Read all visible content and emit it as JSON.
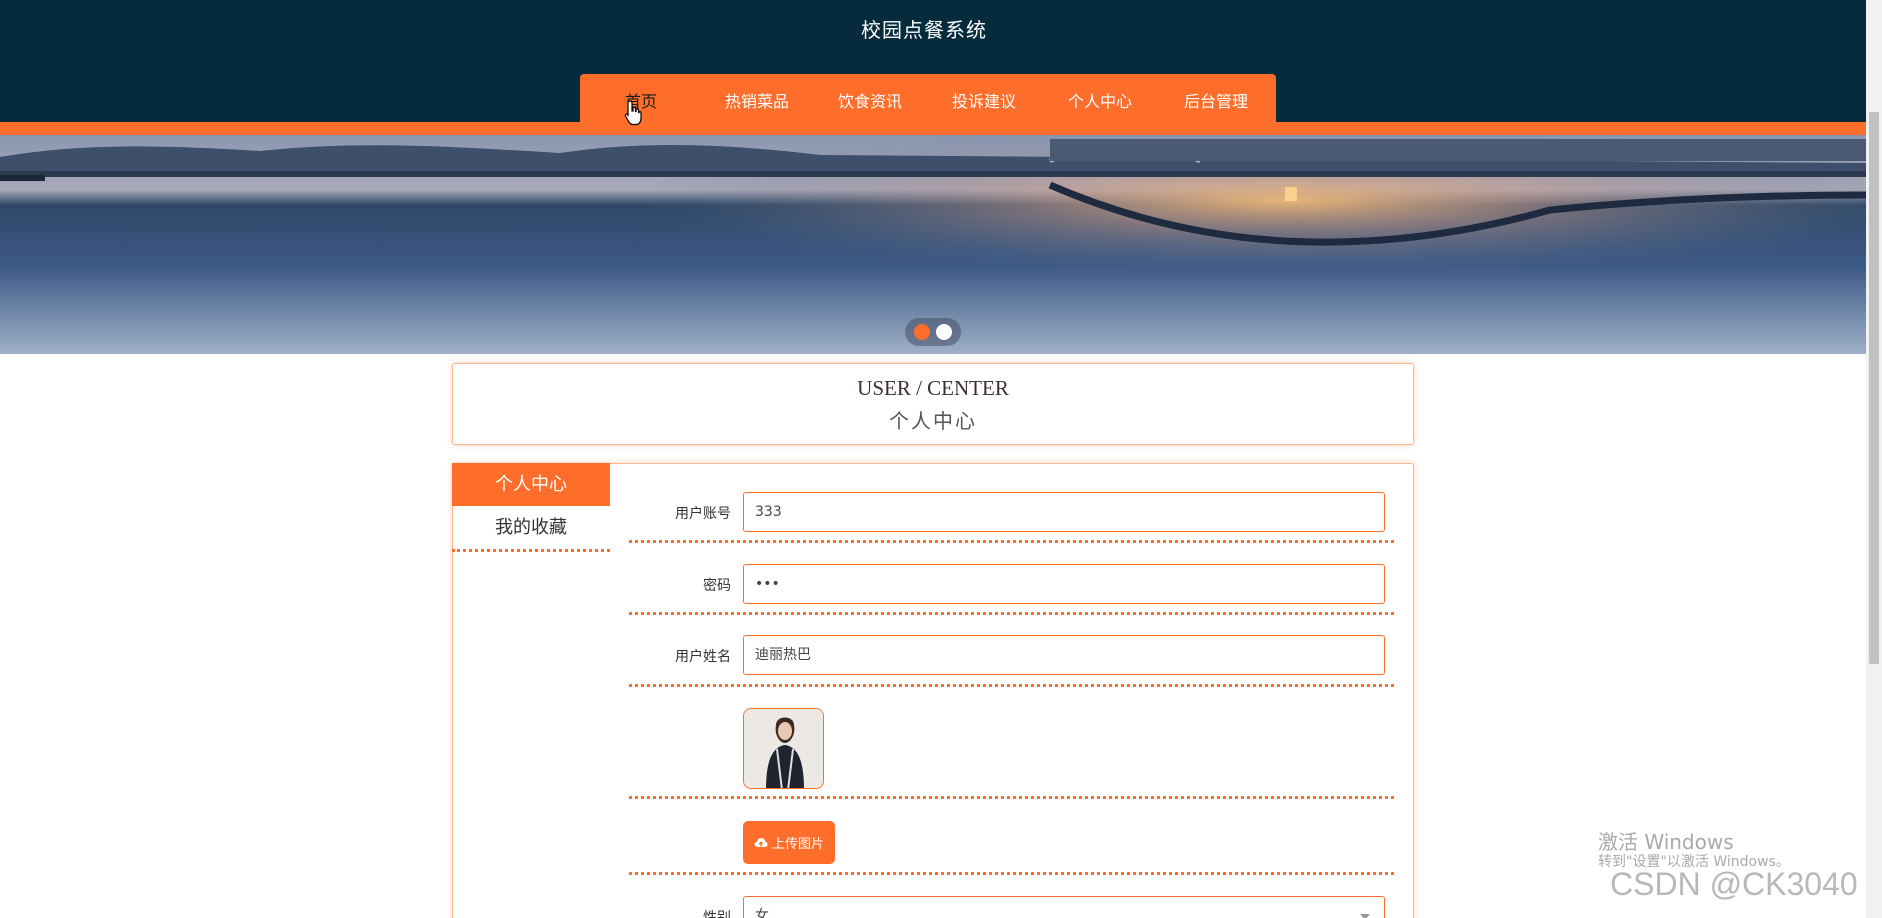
{
  "header": {
    "site_title": "校园点餐系统",
    "nav": [
      {
        "label": "首页",
        "active": true
      },
      {
        "label": "热销菜品",
        "active": false
      },
      {
        "label": "饮食资讯",
        "active": false
      },
      {
        "label": "投诉建议",
        "active": false
      },
      {
        "label": "个人中心",
        "active": false
      },
      {
        "label": "后台管理",
        "active": false
      }
    ]
  },
  "banner": {
    "slide_count": 2,
    "active_slide": 1
  },
  "title_box": {
    "en": "USER / CENTER",
    "cn": "个人中心"
  },
  "side_menu": {
    "items": [
      {
        "label": "个人中心",
        "active": true
      },
      {
        "label": "我的收藏",
        "active": false
      }
    ]
  },
  "form": {
    "account_label": "用户账号",
    "account_value": "333",
    "password_label": "密码",
    "password_value": "•••",
    "name_label": "用户姓名",
    "name_value": "迪丽热巴",
    "upload_label": "上传图片",
    "gender_label": "性别",
    "gender_value": "女"
  },
  "watermark": {
    "line1": "激活 Windows",
    "line2": "转到\"设置\"以激活 Windows。",
    "line3": "CSDN @CK3040"
  },
  "colors": {
    "accent": "#fe6e2a",
    "header_bg": "#052b3c"
  }
}
